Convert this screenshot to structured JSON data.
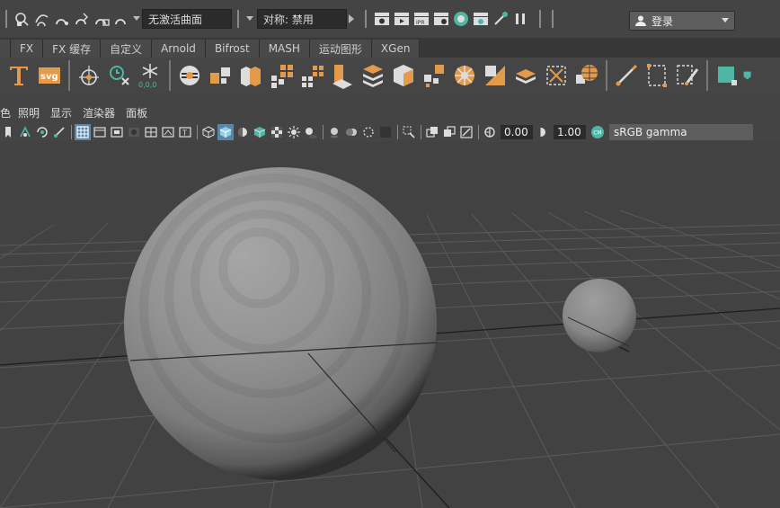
{
  "statusline": {
    "selection_mask_field": "无激活曲面",
    "symmetry_field": "对称: 禁用",
    "login_label": "登录"
  },
  "shelf_tabs": [
    "FX",
    "FX 缓存",
    "自定义",
    "Arnold",
    "Bifrost",
    "MASH",
    "运动图形",
    "XGen"
  ],
  "panel_menu": {
    "partial_first": "色",
    "items": [
      "照明",
      "显示",
      "渲染器",
      "面板"
    ]
  },
  "panel_toolbar": {
    "exposure": "0.00",
    "gamma": "1.00",
    "color_space": "sRGB gamma"
  },
  "colors": {
    "ui_background": "#444444",
    "viewport_background": "#424242",
    "accent_orange": "#e39a4a",
    "accent_teal": "#4db6a4",
    "active_blue": "#5c86a8"
  }
}
